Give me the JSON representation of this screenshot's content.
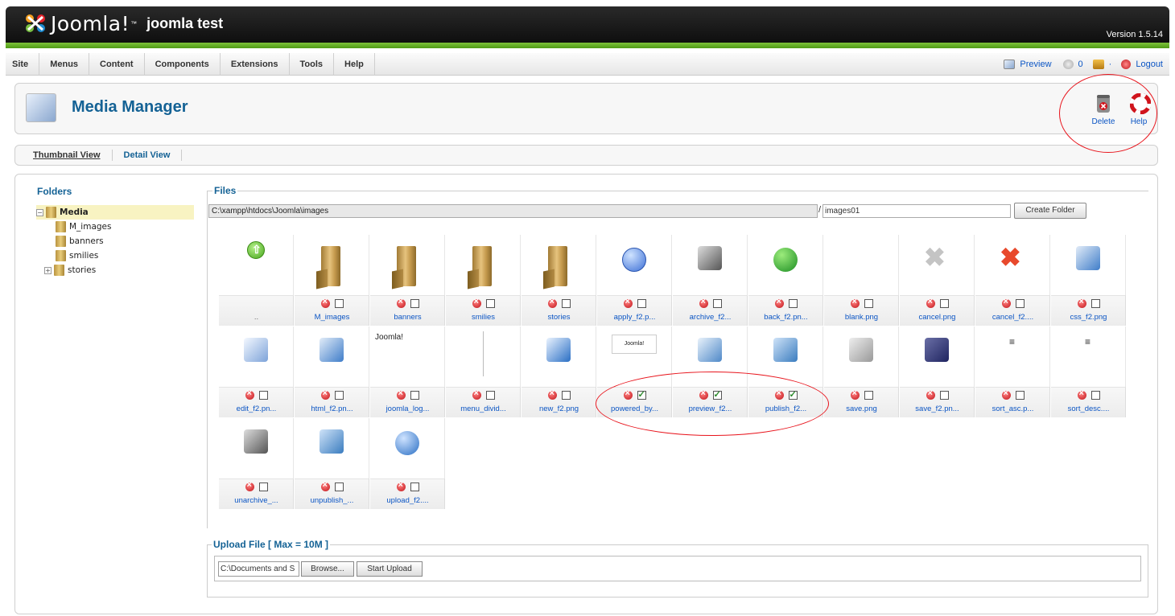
{
  "header": {
    "brand": "Joomla!",
    "brand_tm": "™",
    "site_name": "joomla test",
    "version": "Version 1.5.14"
  },
  "menu": [
    "Site",
    "Menus",
    "Content",
    "Components",
    "Extensions",
    "Tools",
    "Help"
  ],
  "status": {
    "preview": "Preview",
    "messages": "0",
    "users": "·",
    "logout": "Logout"
  },
  "toolbar": {
    "title": "Media Manager",
    "delete": "Delete",
    "help": "Help"
  },
  "submenu": {
    "thumbnail": "Thumbnail View",
    "detail": "Detail View"
  },
  "folders": {
    "title": "Folders",
    "items": [
      {
        "label": "Media"
      },
      {
        "label": "M_images"
      },
      {
        "label": "banners"
      },
      {
        "label": "smilies"
      },
      {
        "label": "stories"
      }
    ]
  },
  "files": {
    "title": "Files",
    "path": "C:\\xampp\\htdocs\\Joomla\\images",
    "separator": "/",
    "new_folder_value": "images01",
    "create_folder": "Create Folder",
    "items": [
      {
        "name": "..",
        "icon": "up-arrow-icon"
      },
      {
        "name": "M_images",
        "icon": "folder-icon",
        "checked": false
      },
      {
        "name": "banners",
        "icon": "folder-icon",
        "checked": false
      },
      {
        "name": "smilies",
        "icon": "folder-icon",
        "checked": false
      },
      {
        "name": "stories",
        "icon": "folder-icon",
        "checked": false
      },
      {
        "name": "apply_f2.p...",
        "icon": "apply-icon",
        "checked": false
      },
      {
        "name": "archive_f2...",
        "icon": "archive-icon",
        "checked": false
      },
      {
        "name": "back_f2.pn...",
        "icon": "back-icon",
        "checked": false
      },
      {
        "name": "blank.png",
        "icon": "blank-icon",
        "checked": false
      },
      {
        "name": "cancel.png",
        "icon": "cancel-grey-icon",
        "checked": false
      },
      {
        "name": "cancel_f2....",
        "icon": "cancel-red-icon",
        "checked": false
      },
      {
        "name": "css_f2.png",
        "icon": "css-icon",
        "checked": false
      },
      {
        "name": "edit_f2.pn...",
        "icon": "edit-icon",
        "checked": false
      },
      {
        "name": "html_f2.pn...",
        "icon": "html-icon",
        "checked": false
      },
      {
        "name": "joomla_log...",
        "icon": "joomla-logo-icon",
        "checked": false
      },
      {
        "name": "menu_divid...",
        "icon": "menu-divider-icon",
        "checked": false
      },
      {
        "name": "new_f2.png",
        "icon": "new-icon",
        "checked": false
      },
      {
        "name": "powered_by...",
        "icon": "powered-by-icon",
        "checked": true
      },
      {
        "name": "preview_f2...",
        "icon": "preview-icon",
        "checked": true
      },
      {
        "name": "publish_f2...",
        "icon": "publish-icon",
        "checked": true
      },
      {
        "name": "save.png",
        "icon": "save-grey-icon",
        "checked": false
      },
      {
        "name": "save_f2.pn...",
        "icon": "save-icon",
        "checked": false
      },
      {
        "name": "sort_asc.p...",
        "icon": "sort-asc-icon",
        "checked": false
      },
      {
        "name": "sort_desc....",
        "icon": "sort-desc-icon",
        "checked": false
      },
      {
        "name": "unarchive_...",
        "icon": "unarchive-icon",
        "checked": false
      },
      {
        "name": "unpublish_...",
        "icon": "unpublish-icon",
        "checked": false
      },
      {
        "name": "upload_f2....",
        "icon": "upload-icon",
        "checked": false
      }
    ]
  },
  "upload": {
    "title": "Upload File [ Max = 10M ]",
    "file_value": "C:\\Documents and S",
    "browse": "Browse...",
    "start": "Start Upload"
  },
  "icon_text": {
    "joomla_logo": "Joomla!",
    "powered": "Joomla!"
  },
  "colors": {
    "link": "#0b55c4",
    "title": "#146295",
    "header_green": "#5fa923",
    "annotation": "#e8141c"
  }
}
